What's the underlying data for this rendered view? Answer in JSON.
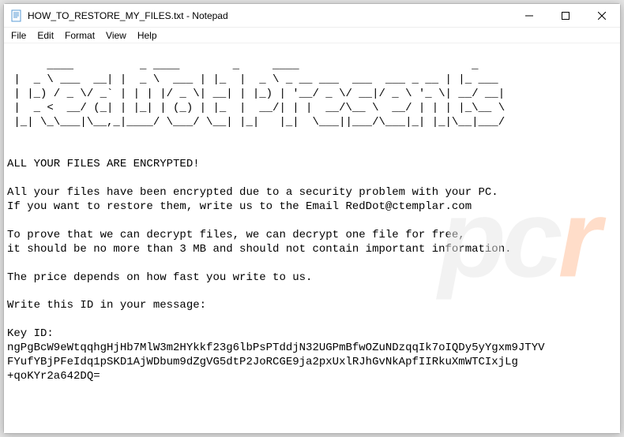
{
  "window": {
    "title": "HOW_TO_RESTORE_MY_FILES.txt - Notepad",
    "icon": "notepad-icon"
  },
  "menu": {
    "file": "File",
    "edit": "Edit",
    "format": "Format",
    "view": "View",
    "help": "Help"
  },
  "content": {
    "ascii_art": "  ____          _ ____        _     ____                          _       \n |  _ \\ ___  __| |  _ \\  ___ | |_  |  _ \\ _ __ ___  ___  ___ _ __ | |_ ___ \n | |_) / _ \\/ _` | | | |/ _ \\| __| | |_) | '__/ _ \\/ __|/ _ \\ '_ \\| __/ __|\n |  _ <  __/ (_| | |_| | (_) | |_  |  __/| | |  __/\\__ \\  __/ | | | |_\\__ \\\n |_| \\_\\___|\\__,_|____/ \\___/ \\__| |_|   |_|  \\___||___/\\___|_| |_|\\__|___/\n",
    "line_after_art": "                                                                           ",
    "heading": "ALL YOUR FILES ARE ENCRYPTED!",
    "p1a": "All your files have been encrypted due to a security problem with your PC.",
    "p1b": "If you want to restore them, write us to the Email RedDot@ctemplar.com",
    "p2a": "To prove that we can decrypt files, we can decrypt one file for free,",
    "p2b": "it should be no more than 3 MB and should not contain important information.",
    "p3": "The price depends on how fast you write to us.",
    "p4": "Write this ID in your message:",
    "key_label": "Key ID:",
    "key1": "ngPgBcW9eWtqqhgHjHb7MlW3m2HYkkf23g6lbPsPTddjN32UGPmBfwOZuNDzqqIk7oIQDy5yYgxm9JTYV",
    "key2": "FYufYBjPFeIdq1pSKD1AjWDbum9dZgVG5dtP2JoRCGE9ja2pxUxlRJhGvNkApfIIRkuXmWTCIxjLg",
    "key3": "+qoKYr2a642DQ="
  },
  "watermark": {
    "pc": "pc",
    "r": "r"
  }
}
